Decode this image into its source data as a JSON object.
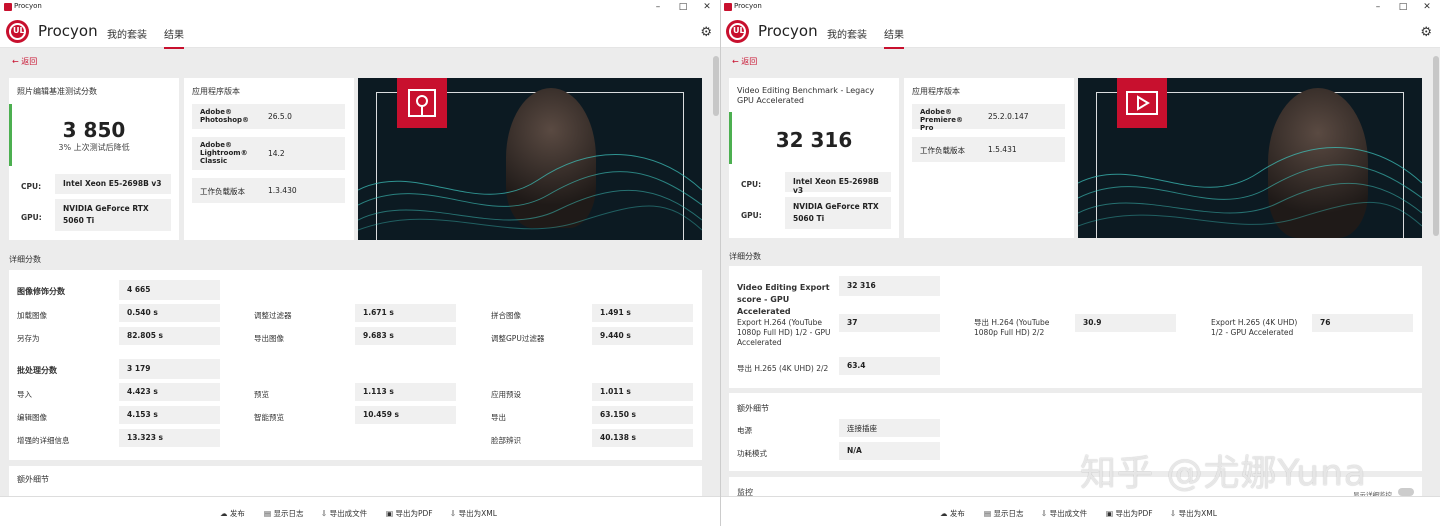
{
  "app": {
    "window_title": "Procyon",
    "brand": "UL",
    "name": "Procyon",
    "nav": [
      "我的套装",
      "结果"
    ],
    "back": "返回"
  },
  "left": {
    "score_title": "照片编辑基准测试分数",
    "score": "3 850",
    "score_note": "3% 上次测试后降低",
    "cpu_label": "CPU:",
    "cpu_value": "Intel Xeon E5-2698B v3",
    "gpu_label": "GPU:",
    "gpu_value": "NVIDIA GeForce RTX 5060 Ti",
    "version_title": "应用程序版本",
    "versions": [
      {
        "name": "Adobe® Photoshop®",
        "value": "26.5.0"
      },
      {
        "name": "Adobe® Lightroom® Classic",
        "value": "14.2"
      },
      {
        "name": "工作负载版本",
        "value": "1.3.430"
      }
    ],
    "detail_title": "详细分数",
    "group1_label": "图像修饰分数",
    "group1_score": "4 665",
    "group1_items": [
      {
        "name": "加载图像",
        "value": "0.540 s"
      },
      {
        "name": "调整过滤器",
        "value": "1.671 s"
      },
      {
        "name": "拼合图像",
        "value": "1.491 s"
      },
      {
        "name": "另存为",
        "value": "82.805 s"
      },
      {
        "name": "导出图像",
        "value": "9.683 s"
      },
      {
        "name": "调整GPU过滤器",
        "value": "9.440 s"
      }
    ],
    "group2_label": "批处理分数",
    "group2_score": "3 179",
    "group2_items": [
      {
        "name": "导入",
        "value": "4.423 s"
      },
      {
        "name": "预览",
        "value": "1.113 s"
      },
      {
        "name": "应用预设",
        "value": "1.011 s"
      },
      {
        "name": "编辑图像",
        "value": "4.153 s"
      },
      {
        "name": "智能预览",
        "value": "10.459 s"
      },
      {
        "name": "导出",
        "value": "63.150 s"
      },
      {
        "name": "增强的详细信息",
        "value": "13.323 s"
      },
      {
        "name": "脸部辨识",
        "value": "40.138 s"
      }
    ],
    "extra_title": "额外细节"
  },
  "right": {
    "score_title": "Video Editing Benchmark - Legacy GPU Accelerated",
    "score": "32 316",
    "cpu_label": "CPU:",
    "cpu_value": "Intel Xeon E5-2698B v3",
    "gpu_label": "GPU:",
    "gpu_value": "NVIDIA GeForce RTX 5060 Ti",
    "version_title": "应用程序版本",
    "versions": [
      {
        "name": "Adobe® Premiere® Pro",
        "value": "25.2.0.147"
      },
      {
        "name": "工作负载版本",
        "value": "1.5.431"
      }
    ],
    "detail_title": "详细分数",
    "group1_label": "Video Editing Export score - GPU Accelerated",
    "group1_score": "32 316",
    "group1_items": [
      {
        "name": "Export H.264 (YouTube 1080p Full HD) 1/2 - GPU Accelerated",
        "value": "37"
      },
      {
        "name": "导出 H.264 (YouTube 1080p Full HD) 2/2",
        "value": "30.9"
      },
      {
        "name": "Export H.265 (4K UHD) 1/2 - GPU Accelerated",
        "value": "76"
      },
      {
        "name": "导出 H.265 (4K UHD) 2/2",
        "value": "63.4"
      }
    ],
    "extra_title": "额外细节",
    "extra_items": [
      {
        "name": "电源",
        "value": "连接插座"
      },
      {
        "name": "功耗模式",
        "value": "N/A"
      }
    ],
    "monitor_title": "监控",
    "monitor_hint": "显示详细监控"
  },
  "footer": [
    "发布",
    "显示日志",
    "导出成文件",
    "导出为PDF",
    "导出为XML"
  ],
  "watermark": "知乎 @尤娜Yuna"
}
